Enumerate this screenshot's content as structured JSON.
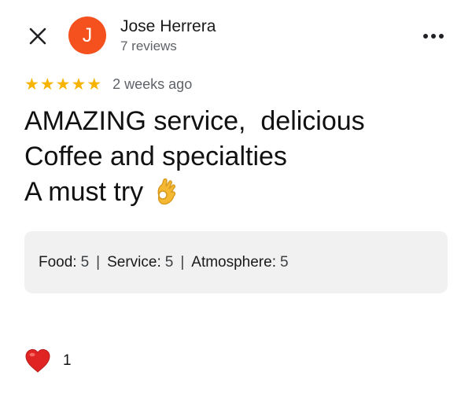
{
  "header": {
    "close_icon": "close-icon",
    "avatar_initial": "J",
    "avatar_color": "#f4511e",
    "reviewer_name": "Jose Herrera",
    "reviewer_meta": "7 reviews",
    "more_icon": "more-horizontal-icon"
  },
  "review": {
    "star_rating": 5,
    "star_color": "#f6b400",
    "date": "2 weeks ago",
    "text_lines": [
      "AMAZING service,  delicious",
      "Coffee and specialties",
      "A must try"
    ],
    "text_emoji_icon": "ok-hand-icon"
  },
  "ratings": {
    "food_label": "Food:",
    "food_value": "5",
    "service_label": "Service:",
    "service_value": "5",
    "atmosphere_label": "Atmosphere:",
    "atmosphere_value": "5",
    "separator": "|"
  },
  "reactions": {
    "heart_icon": "heart-icon",
    "heart_color": "#e02424",
    "like_count": "1"
  }
}
